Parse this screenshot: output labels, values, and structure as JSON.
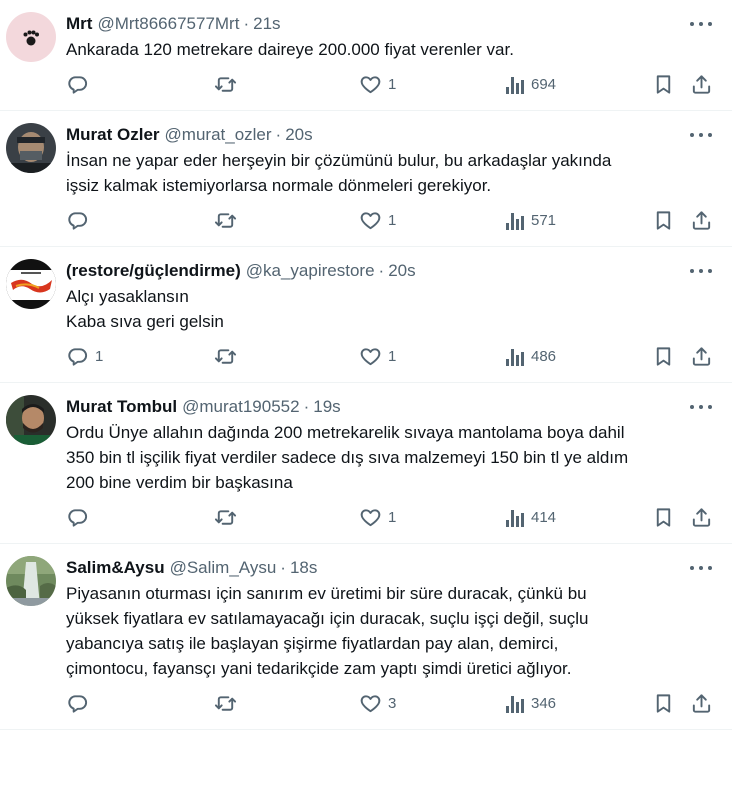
{
  "tweets": [
    {
      "name": "Mrt",
      "handle": "@Mrt86667577Mrt",
      "separator": "·",
      "time": "21s",
      "lines": [
        "Ankarada 120 metrekare daireye 200.000 fiyat verenler var."
      ],
      "stats": {
        "replies": "",
        "retweets": "",
        "likes": "1",
        "views": "694"
      },
      "avatar": {
        "type": "paw-icon",
        "bg": "#f3d8dc"
      }
    },
    {
      "name": "Murat Ozler",
      "handle": "@murat_ozler",
      "separator": "·",
      "time": "20s",
      "lines": [
        "İnsan ne yapar eder herşeyin bir çözümünü bulur, bu arkadaşlar yakında",
        "işsiz kalmak istemiyorlarsa normale dönmeleri gerekiyor."
      ],
      "stats": {
        "replies": "",
        "retweets": "",
        "likes": "1",
        "views": "571"
      },
      "avatar": {
        "type": "soldier-icon",
        "bg": "#3a4046"
      }
    },
    {
      "name": "(restore/güçlendirme)",
      "handle": "@ka_yapirestore",
      "separator": "·",
      "time": "20s",
      "lines": [
        "Alçı yasaklansın",
        "Kaba sıva geri gelsin"
      ],
      "stats": {
        "replies": "1",
        "retweets": "",
        "likes": "1",
        "views": "486"
      },
      "avatar": {
        "type": "brand-logo-icon",
        "bg": "#111111"
      }
    },
    {
      "name": "Murat Tombul",
      "handle": "@murat190552",
      "separator": "·",
      "time": "19s",
      "lines": [
        "Ordu Ünye  allahın dağında  200 metrekarelik sıvaya mantolama  boya dahil",
        "350 bin  tl işçilik fiyat verdiler sadece dış sıva malzemeyi 150 bin tl ye aldım",
        "200 bine verdim bir başkasına"
      ],
      "stats": {
        "replies": "",
        "retweets": "",
        "likes": "1",
        "views": "414"
      },
      "avatar": {
        "type": "person-photo-icon",
        "bg": "#2a2e2a"
      }
    },
    {
      "name": "Salim&Aysu",
      "handle": "@Salim_Aysu",
      "separator": "·",
      "time": "18s",
      "lines": [
        "Piyasanın oturması için sanırım ev üretimi bir süre duracak, çünkü bu",
        "yüksek fiyatlara ev satılamayacağı için duracak, suçlu işçi değil, suçlu",
        "yabancıya satış ile başlayan şişirme fiyatlardan pay alan, demirci,",
        "çimontocu, fayansçı yani tedarikçide zam yaptı şimdi üretici ağlıyor."
      ],
      "stats": {
        "replies": "",
        "retweets": "",
        "likes": "3",
        "views": "346"
      },
      "avatar": {
        "type": "waterfall-photo-icon",
        "bg": "#6f8a5e"
      }
    }
  ]
}
